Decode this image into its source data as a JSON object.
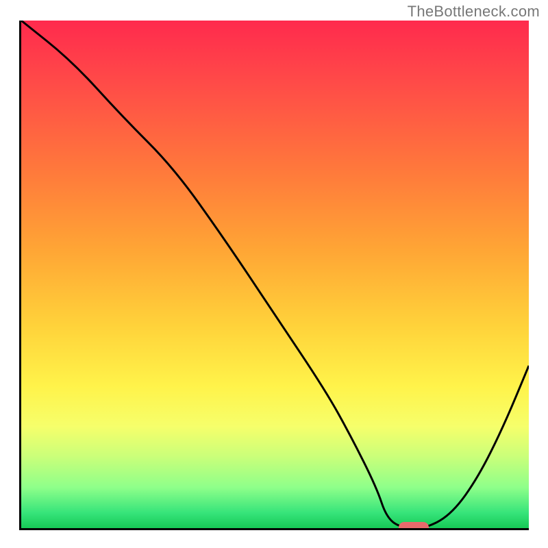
{
  "watermark": "TheBottleneck.com",
  "chart_data": {
    "type": "line",
    "title": "",
    "xlabel": "",
    "ylabel": "",
    "xlim": [
      0,
      100
    ],
    "ylim": [
      0,
      100
    ],
    "grid": false,
    "legend": false,
    "x": [
      0,
      10,
      20,
      30,
      40,
      50,
      60,
      65,
      70,
      72,
      75,
      80,
      85,
      90,
      95,
      100
    ],
    "values": [
      100,
      92,
      81,
      71,
      57,
      42,
      27,
      18,
      8,
      2,
      0,
      0,
      3,
      10,
      20,
      32
    ],
    "marker": {
      "x_center": 77,
      "y": 0,
      "width": 6
    },
    "background_gradient": {
      "stops": [
        {
          "pos": 0,
          "color": "#ff2a4d"
        },
        {
          "pos": 30,
          "color": "#ff7a3b"
        },
        {
          "pos": 60,
          "color": "#ffd23a"
        },
        {
          "pos": 80,
          "color": "#f6ff6b"
        },
        {
          "pos": 100,
          "color": "#17c956"
        }
      ]
    }
  }
}
